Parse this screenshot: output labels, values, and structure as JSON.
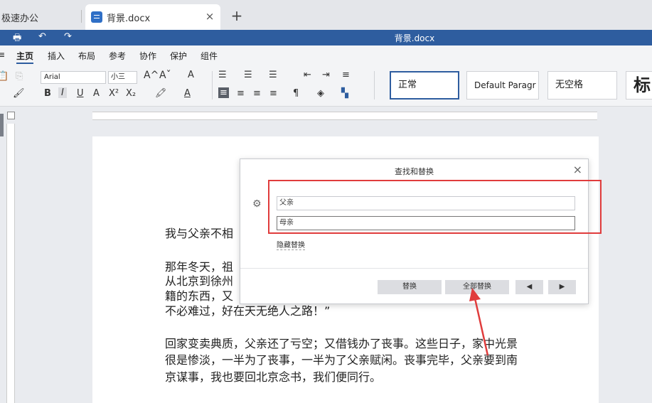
{
  "tabs": [
    {
      "label": "极速办公"
    },
    {
      "label": "背景.docx",
      "close": "×"
    }
  ],
  "new_tab": "+",
  "window_title": "背景.docx",
  "menu": [
    "主页",
    "插入",
    "布局",
    "参考",
    "协作",
    "保护",
    "组件"
  ],
  "ribbon": {
    "font_name": "Arial",
    "font_size": "小三",
    "bold": "B",
    "italic": "I",
    "underline": "U",
    "strike": "A",
    "superscript": "X²",
    "subscript": "X₂",
    "grow": "A^",
    "shrink": "Aˇ",
    "styles": [
      "正常",
      "Default Paragr",
      "无空格",
      "标"
    ]
  },
  "document": {
    "paragraphs": [
      "我与父亲不相",
      "那年冬天，祖",
      "从北京到徐州",
      "籍的东西，又",
      "不必难过，好在天无绝人之路！”",
      "回家变卖典质，父亲还了亏空；又借钱办了丧事。这些日子，家中光景",
      "很是惨淡，一半为了丧事，一半为了父亲赋闲。丧事完毕，父亲要到南",
      "京谋事，我也要回北京念书，我们便同行。"
    ]
  },
  "dialog": {
    "title": "查找和替换",
    "close": "×",
    "find_value": "父亲",
    "replace_value": "母亲",
    "hide_replace": "隐藏替换",
    "btn_replace": "替换",
    "btn_replace_all": "全部替换",
    "btn_prev": "◀",
    "btn_next": "▶"
  },
  "annotation_color": "#e03c3c",
  "accent_color": "#2e5d9f"
}
